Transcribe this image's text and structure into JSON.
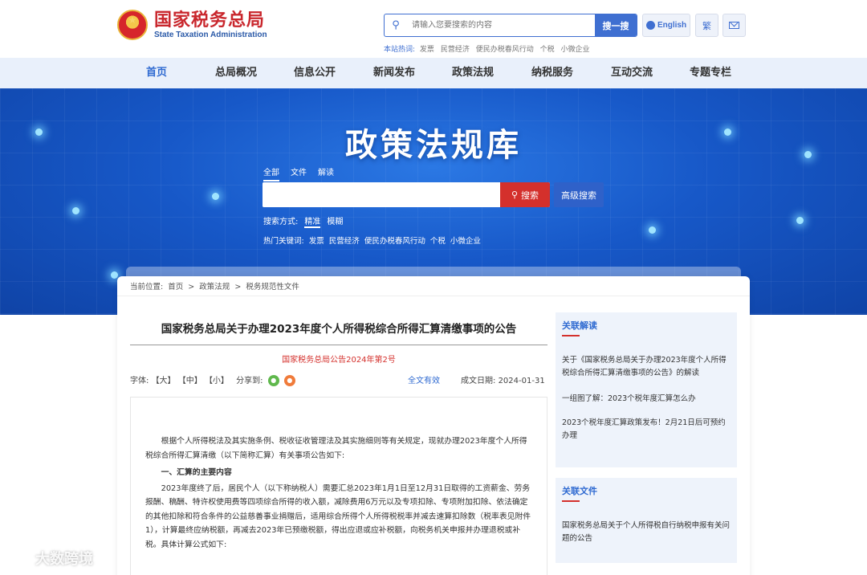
{
  "header": {
    "logo_cn": "国家税务总局",
    "logo_en": "State Taxation Administration",
    "search_placeholder": "请输入您要搜索的内容",
    "search_button": "搜一搜",
    "lang_button": "English",
    "trad_button": "繁",
    "hotwords_label": "本站热词:",
    "hotwords": [
      "发票",
      "民营经济",
      "便民办税春风行动",
      "个税",
      "小微企业"
    ]
  },
  "nav": {
    "items": [
      {
        "label": "首页",
        "active": true
      },
      {
        "label": "总局概况",
        "active": false
      },
      {
        "label": "信息公开",
        "active": false
      },
      {
        "label": "新闻发布",
        "active": false
      },
      {
        "label": "政策法规",
        "active": false
      },
      {
        "label": "纳税服务",
        "active": false
      },
      {
        "label": "互动交流",
        "active": false
      },
      {
        "label": "专题专栏",
        "active": false
      }
    ]
  },
  "banner": {
    "title": "政策法规库",
    "scope_tabs": [
      "全部",
      "文件",
      "解读"
    ],
    "search_button": "搜索",
    "advanced_button": "高级搜索",
    "search_mode_label": "搜索方式:",
    "search_modes": [
      "精准",
      "模糊"
    ],
    "hot_label": "热门关键词:",
    "hot_words": [
      "发票",
      "民营经济",
      "便民办税春风行动",
      "个税",
      "小微企业"
    ]
  },
  "breadcrumb": {
    "label": "当前位置:",
    "items": [
      "首页",
      "政策法规",
      "税务规范性文件"
    ],
    "separator": ">"
  },
  "article": {
    "title": "国家税务总局关于办理2023年度个人所得税综合所得汇算清缴事项的公告",
    "doc_number": "国家税务总局公告2024年第2号",
    "font_label": "字体:",
    "font_sizes": [
      "【大】",
      "【中】",
      "【小】"
    ],
    "share_label": "分享到:",
    "validity": "全文有效",
    "date_label": "成文日期:",
    "date": "2024-01-31",
    "para1": "根据个人所得税法及其实施条例、税收征收管理法及其实施细则等有关规定，现就办理2023年度个人所得税综合所得汇算清缴（以下简称汇算）有关事项公告如下:",
    "heading1": "一、汇算的主要内容",
    "para2": "2023年度终了后，居民个人（以下称纳税人）需要汇总2023年1月1日至12月31日取得的工资薪金、劳务报酬、稿酬、特许权使用费等四项综合所得的收入额，减除费用6万元以及专项扣除、专项附加扣除、依法确定的其他扣除和符合条件的公益慈善事业捐赠后，适用综合所得个人所得税税率并减去速算扣除数（税率表见附件1），计算最终应纳税额，再减去2023年已预缴税额，得出应退或应补税额，向税务机关申报并办理退税或补税。具体计算公式如下:"
  },
  "sidebar": {
    "related_reading": {
      "heading": "关联解读",
      "links": [
        "关于《国家税务总局关于办理2023年度个人所得税综合所得汇算清缴事项的公告》的解读",
        "一组图了解：2023个税年度汇算怎么办",
        "2023个税年度汇算政策发布！2月21日后可预约办理"
      ]
    },
    "related_files": {
      "heading": "关联文件",
      "links": [
        "国家税务总局关于个人所得税自行纳税申报有关问题的公告"
      ]
    }
  },
  "watermark": "大数跨境",
  "colors": {
    "brand_red": "#c9272d",
    "primary_blue": "#2f6ad1",
    "nav_bg": "#e9f0fb"
  }
}
